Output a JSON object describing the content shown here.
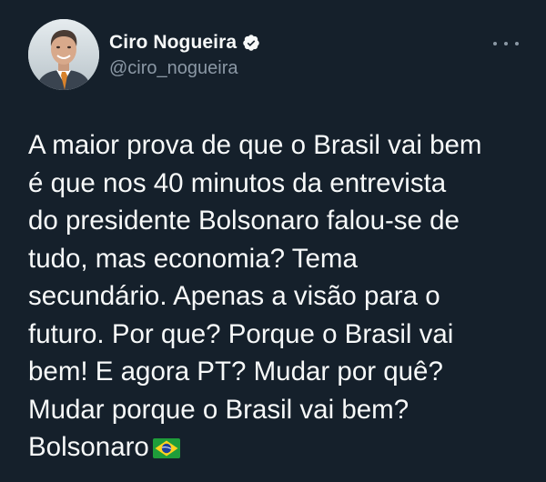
{
  "author": {
    "display_name": "Ciro Nogueira",
    "handle": "@ciro_nogueira",
    "verified": true
  },
  "tweet": {
    "text": "A maior prova de que o Brasil vai bem\né que nos 40 minutos da entrevista\ndo presidente Bolsonaro falou-se de\ntudo, mas economia? Tema\nsecundário. Apenas a visão para o\nfuturo. Por que? Porque o Brasil vai\nbem! E agora PT? Mudar por quê?\nMudar porque o Brasil vai bem?\nBolsonaro",
    "trailing_emoji": "brazil-flag"
  },
  "colors": {
    "background": "#15202b",
    "text_primary": "#f7f9f9",
    "text_secondary": "#8b98a5",
    "verified_badge": "#f7f9f9"
  },
  "icons": {
    "verified": "verified-badge-icon",
    "more": "more-options-icon",
    "flag": "brazil-flag-icon"
  }
}
